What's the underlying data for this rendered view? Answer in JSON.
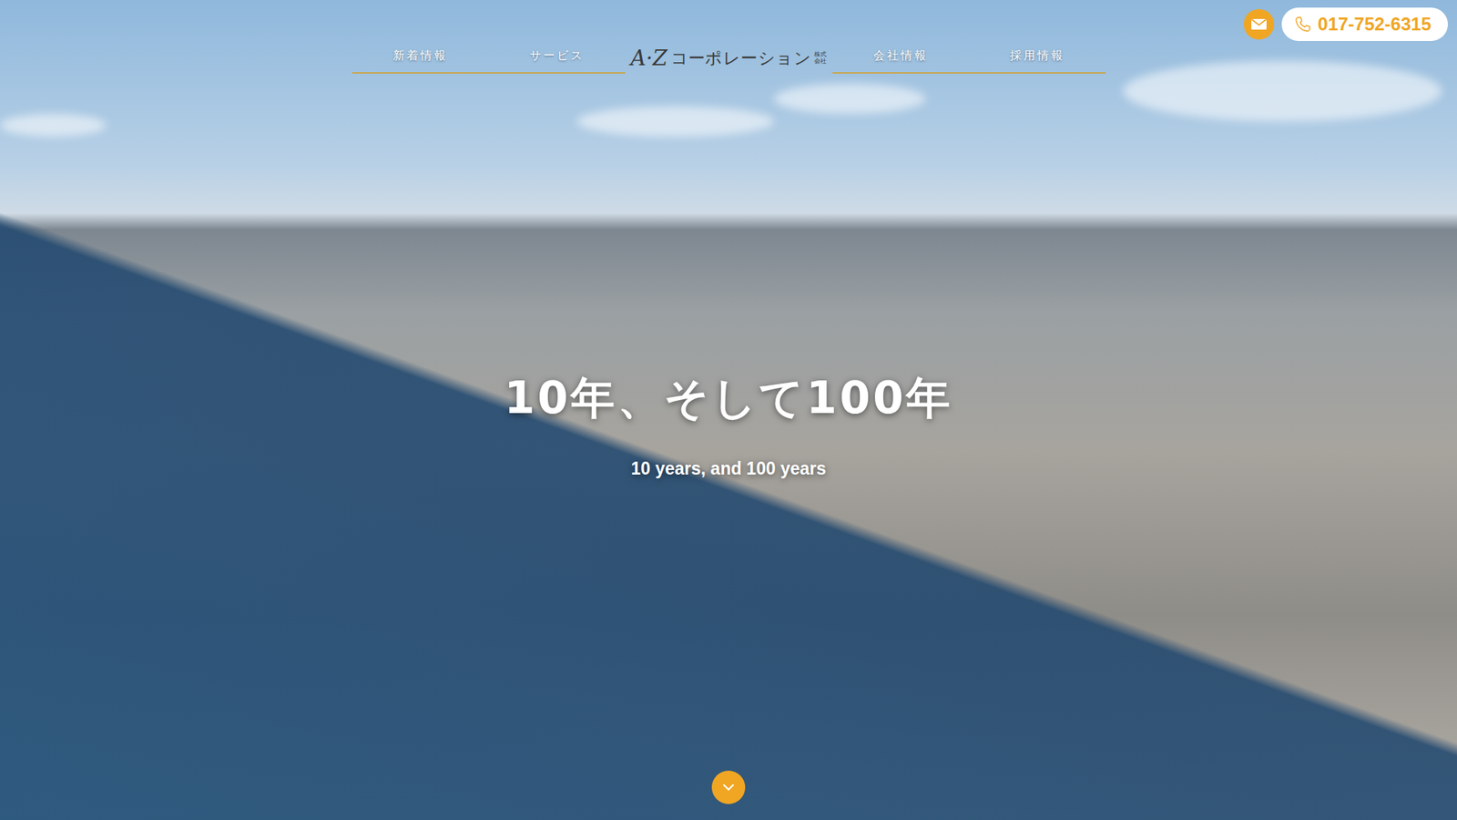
{
  "header": {
    "nav_left": [
      {
        "label": "新着情報"
      },
      {
        "label": "サービス"
      }
    ],
    "logo": {
      "mark": "A·Z",
      "name": "コーポレーション",
      "suffix": "株式会社"
    },
    "nav_right": [
      {
        "label": "会社情報"
      },
      {
        "label": "採用情報"
      }
    ]
  },
  "contact": {
    "phone": "017-752-6315"
  },
  "hero": {
    "title": "10年、そして100年",
    "subtitle": "10 years, and 100 years"
  }
}
